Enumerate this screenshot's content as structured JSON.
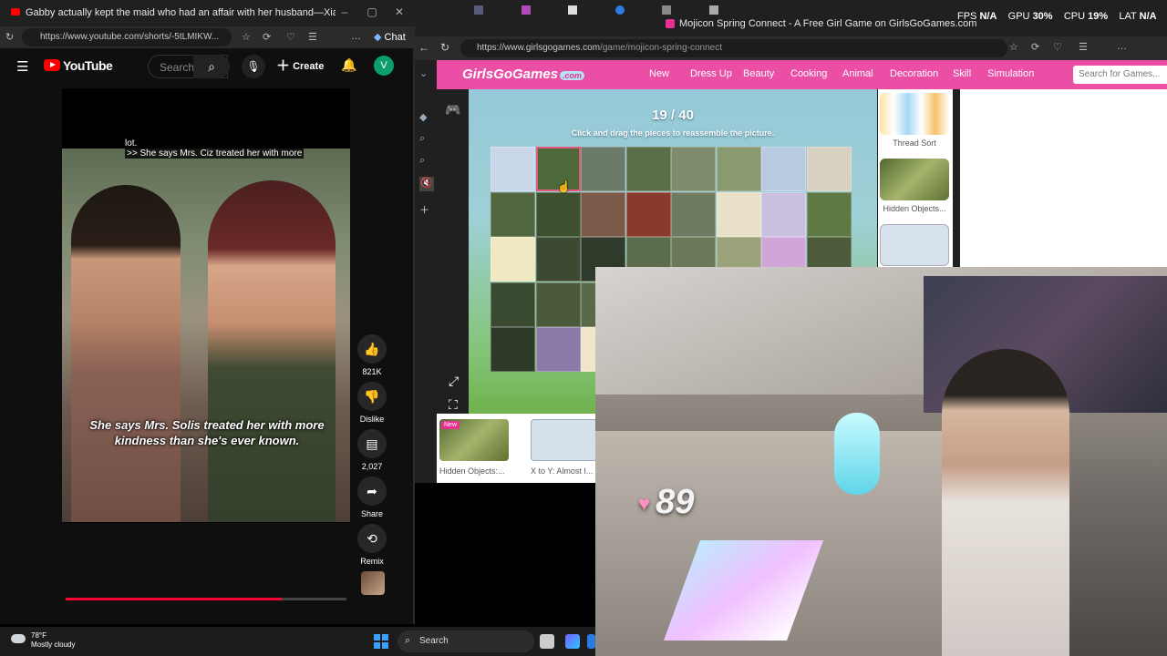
{
  "youtube_window": {
    "tab_title": "Gabby actually kept the maid who had an affair with her husband—Xiaomei.#...",
    "url": "https://www.youtube.com/shorts/-5tLMIKW...",
    "chat_label": "Chat",
    "logo_text": "YouTube",
    "search_placeholder": "Search",
    "create_label": "Create",
    "avatar_letter": "V",
    "caption_top_line1": "lot.",
    "caption_top_line2": ">> She says Mrs. Ciz treated her with more",
    "caption_main": "She says Mrs. Solis treated her with more kindness than she's ever known.",
    "actions": {
      "like_count": "821K",
      "dislike_label": "Dislike",
      "comments_count": "2,027",
      "share_label": "Share",
      "remix_label": "Remix"
    },
    "progress_fraction": 0.77
  },
  "game_window": {
    "tab_title": "Mojicon Spring Connect - A Free Girl Game on GirlsGoGames.com",
    "url_domain": "https://www.girlsgogames.com",
    "url_path": "/game/mojicon-spring-connect",
    "logo_text": "GirlsGoGames",
    "logo_suffix": ".com",
    "nav_items": [
      "New",
      "Dress Up",
      "Beauty",
      "Cooking",
      "Animal",
      "Decoration",
      "Skill",
      "Simulation"
    ],
    "search_placeholder": "Search for Games...",
    "counter": "19 / 40",
    "hint": "Click and drag the pieces to reassemble the picture.",
    "sidebar_games": [
      {
        "name": "Thread Sort"
      },
      {
        "name": "Hidden Objects..."
      }
    ],
    "bottom_games": [
      {
        "name": "Hidden Objects:...",
        "badge": "New"
      },
      {
        "name": "X to Y: Almost I..."
      }
    ]
  },
  "hud": {
    "fps_label": "FPS",
    "fps_value": "N/A",
    "gpu_label": "GPU",
    "gpu_value": "30%",
    "cpu_label": "CPU",
    "cpu_value": "19%",
    "lat_label": "LAT",
    "lat_value": "N/A"
  },
  "overlay": {
    "heart_count": "89",
    "heart_color": "#ff8fc0"
  },
  "taskbar": {
    "temperature": "78°F",
    "weather": "Mostly cloudy",
    "search_label": "Search"
  },
  "colors": {
    "youtube_red": "#ff0000",
    "ggg_pink": "#ea4fa5",
    "yt_avatar": "#0b9e6b"
  }
}
